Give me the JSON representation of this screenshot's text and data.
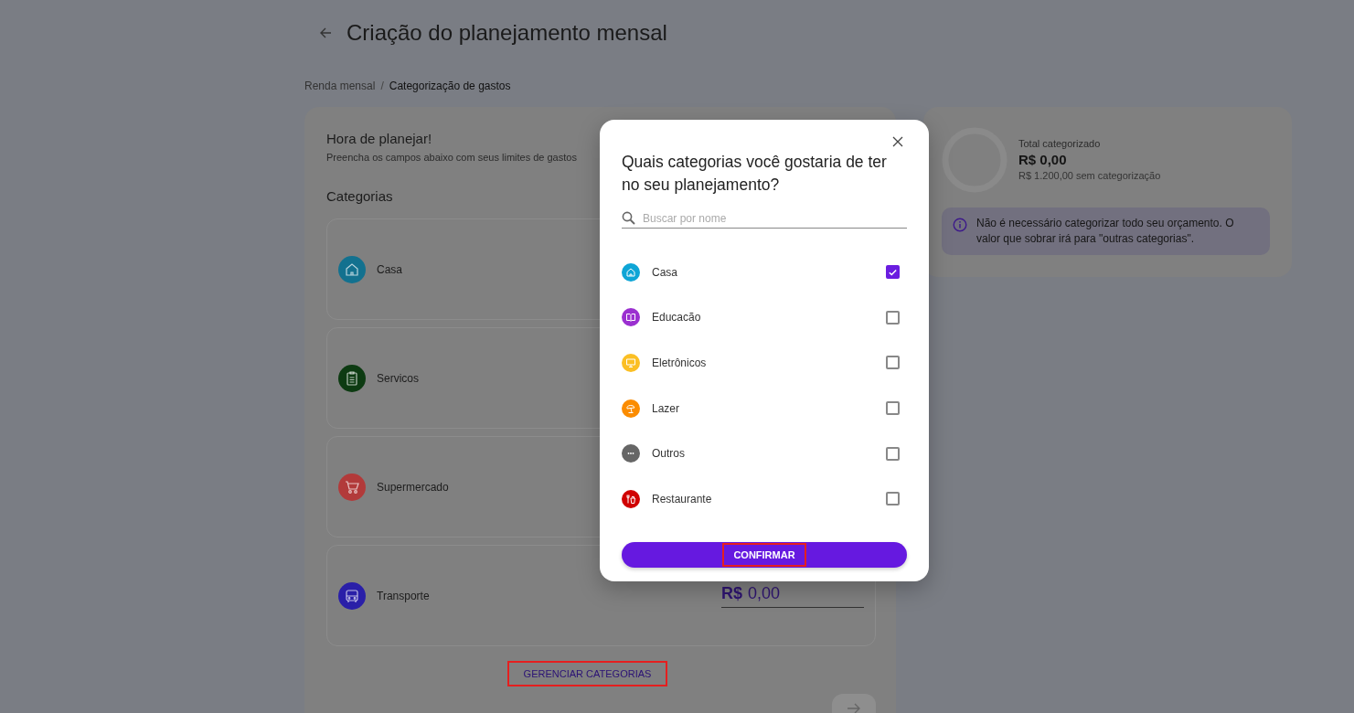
{
  "header": {
    "title": "Criação do planejamento mensal"
  },
  "breadcrumb_separator": "/",
  "breadcrumb": [
    {
      "label": "Renda mensal",
      "selected": false
    },
    {
      "label": "Categorização de gastos",
      "selected": true
    }
  ],
  "planning": {
    "title": "Hora de planejar!",
    "subtitle": "Preencha os campos abaixo com seus limites de gastos",
    "section_title": "Categorias",
    "categories": [
      {
        "name": "Casa",
        "kind": "house",
        "color": "#13718f"
      },
      {
        "name": "Servicos",
        "kind": "clipboard",
        "color": "#0d3b12"
      },
      {
        "name": "Supermercado",
        "kind": "cart",
        "color": "#b23a3a"
      },
      {
        "name": "Transporte",
        "kind": "bus",
        "color": "#2a1fa8",
        "currency": "R$",
        "amount": "0,00"
      }
    ],
    "manage_button": {
      "label": "GERENCIAR CATEGORIAS",
      "highlighted": true
    }
  },
  "summary": {
    "label": "Total categorizado",
    "total": "R$ 0,00",
    "remaining": "R$ 1.200,00 sem categorização",
    "info": "Não é necessário categorizar todo seu orçamento. O valor que sobrar irá para \"outras categorias\"."
  },
  "dialog": {
    "title": "Quais categorias você gostaria de ter no seu planejamento?",
    "search": {
      "placeholder": "Buscar por nome"
    },
    "options": [
      {
        "name": "Casa",
        "kind": "house",
        "color": "#0ea5d6",
        "checked": true
      },
      {
        "name": "Educacão",
        "kind": "book",
        "color": "#9b30d0",
        "checked": false
      },
      {
        "name": "Eletrônicos",
        "kind": "monitor",
        "color": "#fbbf24",
        "checked": false
      },
      {
        "name": "Lazer",
        "kind": "umbrella",
        "color": "#fb8c00",
        "checked": false
      },
      {
        "name": "Outros",
        "kind": "dots",
        "color": "#666666",
        "checked": false
      },
      {
        "name": "Restaurante",
        "kind": "food",
        "color": "#d00000",
        "checked": false
      }
    ],
    "confirm_button": {
      "label": "CONFIRMAR",
      "highlighted": true
    }
  }
}
